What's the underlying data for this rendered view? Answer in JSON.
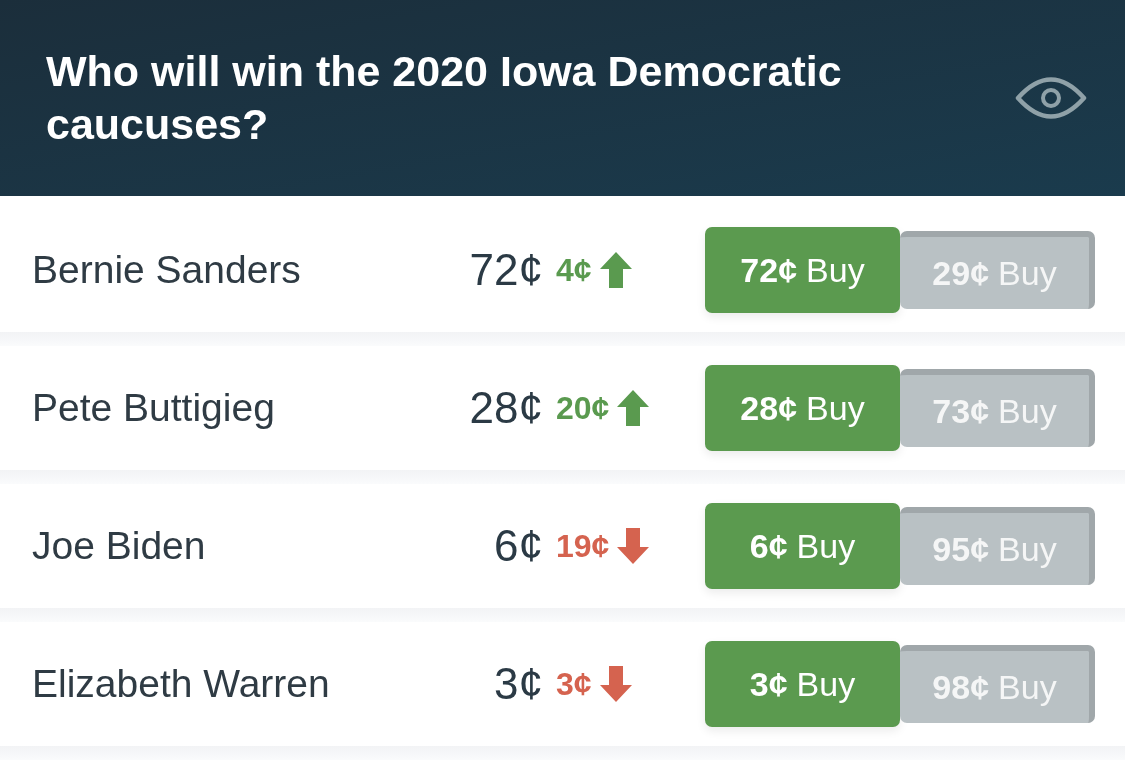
{
  "header": {
    "title": "Who will win the 2020 Iowa Democratic caucuses?"
  },
  "candidates": [
    {
      "name": "Bernie Sanders",
      "price": "72¢",
      "change": "4¢",
      "kind": "up",
      "buy_yes": {
        "price": "72¢",
        "label": "Buy"
      },
      "buy_no": {
        "price": "29¢",
        "label": "Buy"
      }
    },
    {
      "name": "Pete Buttigieg",
      "price": "28¢",
      "change": "20¢",
      "kind": "up",
      "buy_yes": {
        "price": "28¢",
        "label": "Buy"
      },
      "buy_no": {
        "price": "73¢",
        "label": "Buy"
      }
    },
    {
      "name": "Joe Biden",
      "price": "6¢",
      "change": "19¢",
      "kind": "down",
      "buy_yes": {
        "price": "6¢",
        "label": "Buy"
      },
      "buy_no": {
        "price": "95¢",
        "label": "Buy"
      }
    },
    {
      "name": "Elizabeth Warren",
      "price": "3¢",
      "change": "3¢",
      "kind": "down",
      "buy_yes": {
        "price": "3¢",
        "label": "Buy"
      },
      "buy_no": {
        "price": "98¢",
        "label": "Buy"
      }
    }
  ]
}
